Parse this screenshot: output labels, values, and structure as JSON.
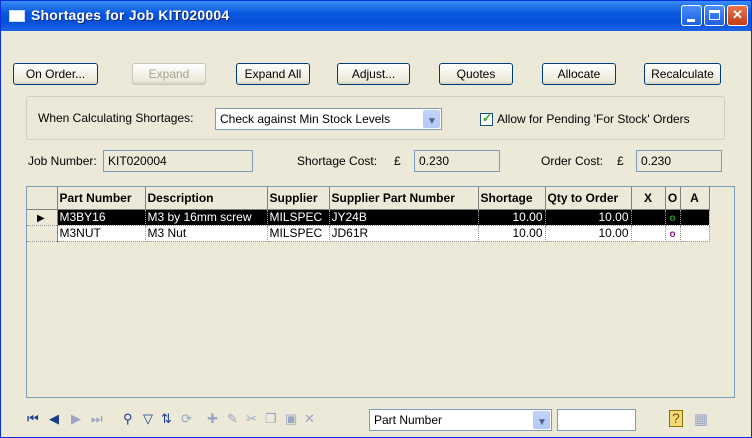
{
  "window": {
    "title": "Shortages for Job KIT020004"
  },
  "toolbar": {
    "on_order": "On Order...",
    "expand": "Expand",
    "expand_all": "Expand All",
    "adjust": "Adjust...",
    "quotes": "Quotes",
    "allocate": "Allocate",
    "recalculate": "Recalculate"
  },
  "calc": {
    "label": "When Calculating Shortages:",
    "selected": "Check against Min Stock Levels",
    "pending_label": "Allow for Pending 'For Stock' Orders",
    "pending_checked": true
  },
  "info": {
    "job_label": "Job Number:",
    "job_value": "KIT020004",
    "shortage_label": "Shortage Cost:",
    "shortage_currency": "£",
    "shortage_value": "0.230",
    "order_label": "Order Cost:",
    "order_currency": "£",
    "order_value": "0.230"
  },
  "grid": {
    "columns": [
      "Part Number",
      "Description",
      "Supplier",
      "Supplier Part Number",
      "Shortage",
      "Qty to Order",
      "X",
      "O",
      "A"
    ],
    "rows": [
      {
        "part": "M3BY16",
        "desc": "M3 by 16mm screw",
        "supplier": "MILSPEC",
        "spn": "JY24B",
        "shortage": "10.00",
        "qty": "10.00",
        "x": "",
        "o": "o",
        "a": "",
        "o_color": "#22a022"
      },
      {
        "part": "M3NUT",
        "desc": "M3 Nut",
        "supplier": "MILSPEC",
        "spn": "JD61R",
        "shortage": "10.00",
        "qty": "10.00",
        "x": "",
        "o": "o",
        "a": "",
        "o_color": "#8b1a8b"
      }
    ]
  },
  "navigator": {
    "sort_field": "Part Number",
    "search_value": ""
  }
}
